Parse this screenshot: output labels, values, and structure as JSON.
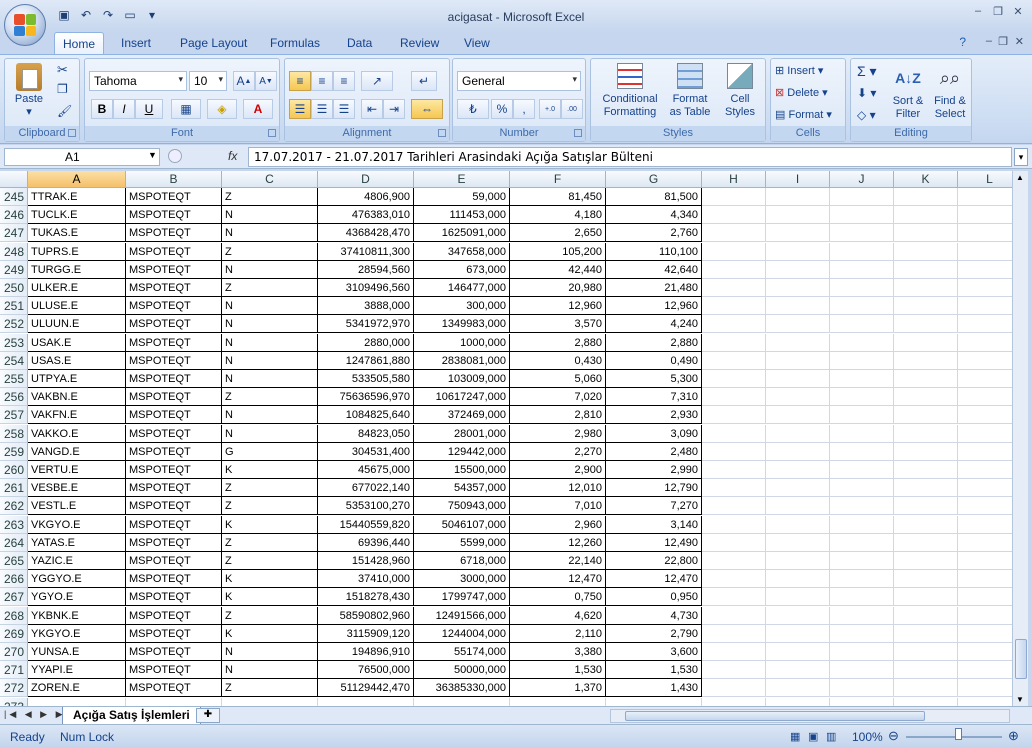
{
  "window": {
    "title": "acigasat - Microsoft Excel"
  },
  "ribbon_tabs": [
    "Home",
    "Insert",
    "Page Layout",
    "Formulas",
    "Data",
    "Review",
    "View"
  ],
  "ribbon": {
    "paste": "Paste",
    "clipboard_label": "Clipboard",
    "font_name": "Tahoma",
    "font_size": "10",
    "font_label": "Font",
    "bold": "B",
    "italic": "I",
    "underline": "U",
    "alignment_label": "Alignment",
    "number_format": "General",
    "number_label": "Number",
    "percent": "%",
    "comma": ",",
    "inc_decimal": "+.0 .00",
    "dec_decimal": ".00 →.0",
    "conditional_formatting": "Conditional Formatting",
    "format_as_table": "Format as Table",
    "cell_styles": "Cell Styles",
    "styles_label": "Styles",
    "insert": "Insert",
    "delete": "Delete",
    "format": "Format",
    "cells_label": "Cells",
    "sort_filter": "Sort & Filter",
    "find_select": "Find & Select",
    "editing_label": "Editing"
  },
  "formula_bar": {
    "name_box": "A1",
    "fx": "fx",
    "content": "17.07.2017 - 21.07.2017 Tarihleri Arasindaki Açığa Satışlar Bülteni"
  },
  "columns": [
    "A",
    "B",
    "C",
    "D",
    "E",
    "F",
    "G",
    "H",
    "I",
    "J",
    "K",
    "L"
  ],
  "rows": [
    {
      "n": "245",
      "a": "TTRAK.E",
      "b": "MSPOTEQT",
      "c": "Z",
      "d": "4806,900",
      "e": "59,000",
      "f": "81,450",
      "g": "81,500"
    },
    {
      "n": "246",
      "a": "TUCLK.E",
      "b": "MSPOTEQT",
      "c": "N",
      "d": "476383,010",
      "e": "111453,000",
      "f": "4,180",
      "g": "4,340"
    },
    {
      "n": "247",
      "a": "TUKAS.E",
      "b": "MSPOTEQT",
      "c": "N",
      "d": "4368428,470",
      "e": "1625091,000",
      "f": "2,650",
      "g": "2,760"
    },
    {
      "n": "248",
      "a": "TUPRS.E",
      "b": "MSPOTEQT",
      "c": "Z",
      "d": "37410811,300",
      "e": "347658,000",
      "f": "105,200",
      "g": "110,100"
    },
    {
      "n": "249",
      "a": "TURGG.E",
      "b": "MSPOTEQT",
      "c": "N",
      "d": "28594,560",
      "e": "673,000",
      "f": "42,440",
      "g": "42,640"
    },
    {
      "n": "250",
      "a": "ULKER.E",
      "b": "MSPOTEQT",
      "c": "Z",
      "d": "3109496,560",
      "e": "146477,000",
      "f": "20,980",
      "g": "21,480"
    },
    {
      "n": "251",
      "a": "ULUSE.E",
      "b": "MSPOTEQT",
      "c": "N",
      "d": "3888,000",
      "e": "300,000",
      "f": "12,960",
      "g": "12,960"
    },
    {
      "n": "252",
      "a": "ULUUN.E",
      "b": "MSPOTEQT",
      "c": "N",
      "d": "5341972,970",
      "e": "1349983,000",
      "f": "3,570",
      "g": "4,240"
    },
    {
      "n": "253",
      "a": "USAK.E",
      "b": "MSPOTEQT",
      "c": "N",
      "d": "2880,000",
      "e": "1000,000",
      "f": "2,880",
      "g": "2,880"
    },
    {
      "n": "254",
      "a": "USAS.E",
      "b": "MSPOTEQT",
      "c": "N",
      "d": "1247861,880",
      "e": "2838081,000",
      "f": "0,430",
      "g": "0,490"
    },
    {
      "n": "255",
      "a": "UTPYA.E",
      "b": "MSPOTEQT",
      "c": "N",
      "d": "533505,580",
      "e": "103009,000",
      "f": "5,060",
      "g": "5,300"
    },
    {
      "n": "256",
      "a": "VAKBN.E",
      "b": "MSPOTEQT",
      "c": "Z",
      "d": "75636596,970",
      "e": "10617247,000",
      "f": "7,020",
      "g": "7,310"
    },
    {
      "n": "257",
      "a": "VAKFN.E",
      "b": "MSPOTEQT",
      "c": "N",
      "d": "1084825,640",
      "e": "372469,000",
      "f": "2,810",
      "g": "2,930"
    },
    {
      "n": "258",
      "a": "VAKKO.E",
      "b": "MSPOTEQT",
      "c": "N",
      "d": "84823,050",
      "e": "28001,000",
      "f": "2,980",
      "g": "3,090"
    },
    {
      "n": "259",
      "a": "VANGD.E",
      "b": "MSPOTEQT",
      "c": "G",
      "d": "304531,400",
      "e": "129442,000",
      "f": "2,270",
      "g": "2,480"
    },
    {
      "n": "260",
      "a": "VERTU.E",
      "b": "MSPOTEQT",
      "c": "K",
      "d": "45675,000",
      "e": "15500,000",
      "f": "2,900",
      "g": "2,990"
    },
    {
      "n": "261",
      "a": "VESBE.E",
      "b": "MSPOTEQT",
      "c": "Z",
      "d": "677022,140",
      "e": "54357,000",
      "f": "12,010",
      "g": "12,790"
    },
    {
      "n": "262",
      "a": "VESTL.E",
      "b": "MSPOTEQT",
      "c": "Z",
      "d": "5353100,270",
      "e": "750943,000",
      "f": "7,010",
      "g": "7,270"
    },
    {
      "n": "263",
      "a": "VKGYO.E",
      "b": "MSPOTEQT",
      "c": "K",
      "d": "15440559,820",
      "e": "5046107,000",
      "f": "2,960",
      "g": "3,140"
    },
    {
      "n": "264",
      "a": "YATAS.E",
      "b": "MSPOTEQT",
      "c": "Z",
      "d": "69396,440",
      "e": "5599,000",
      "f": "12,260",
      "g": "12,490"
    },
    {
      "n": "265",
      "a": "YAZIC.E",
      "b": "MSPOTEQT",
      "c": "Z",
      "d": "151428,960",
      "e": "6718,000",
      "f": "22,140",
      "g": "22,800"
    },
    {
      "n": "266",
      "a": "YGGYO.E",
      "b": "MSPOTEQT",
      "c": "K",
      "d": "37410,000",
      "e": "3000,000",
      "f": "12,470",
      "g": "12,470"
    },
    {
      "n": "267",
      "a": "YGYO.E",
      "b": "MSPOTEQT",
      "c": "K",
      "d": "1518278,430",
      "e": "1799747,000",
      "f": "0,750",
      "g": "0,950"
    },
    {
      "n": "268",
      "a": "YKBNK.E",
      "b": "MSPOTEQT",
      "c": "Z",
      "d": "58590802,960",
      "e": "12491566,000",
      "f": "4,620",
      "g": "4,730"
    },
    {
      "n": "269",
      "a": "YKGYO.E",
      "b": "MSPOTEQT",
      "c": "K",
      "d": "3115909,120",
      "e": "1244004,000",
      "f": "2,110",
      "g": "2,790"
    },
    {
      "n": "270",
      "a": "YUNSA.E",
      "b": "MSPOTEQT",
      "c": "N",
      "d": "194896,910",
      "e": "55174,000",
      "f": "3,380",
      "g": "3,600"
    },
    {
      "n": "271",
      "a": "YYAPI.E",
      "b": "MSPOTEQT",
      "c": "N",
      "d": "76500,000",
      "e": "50000,000",
      "f": "1,530",
      "g": "1,530"
    },
    {
      "n": "272",
      "a": "ZOREN.E",
      "b": "MSPOTEQT",
      "c": "Z",
      "d": "51129442,470",
      "e": "36385330,000",
      "f": "1,370",
      "g": "1,430"
    },
    {
      "n": "273",
      "a": "",
      "b": "",
      "c": "",
      "d": "",
      "e": "",
      "f": "",
      "g": ""
    }
  ],
  "sheet_tab": "Açığa Satış İşlemleri",
  "status": {
    "ready": "Ready",
    "numlock": "Num Lock",
    "zoom": "100%"
  }
}
